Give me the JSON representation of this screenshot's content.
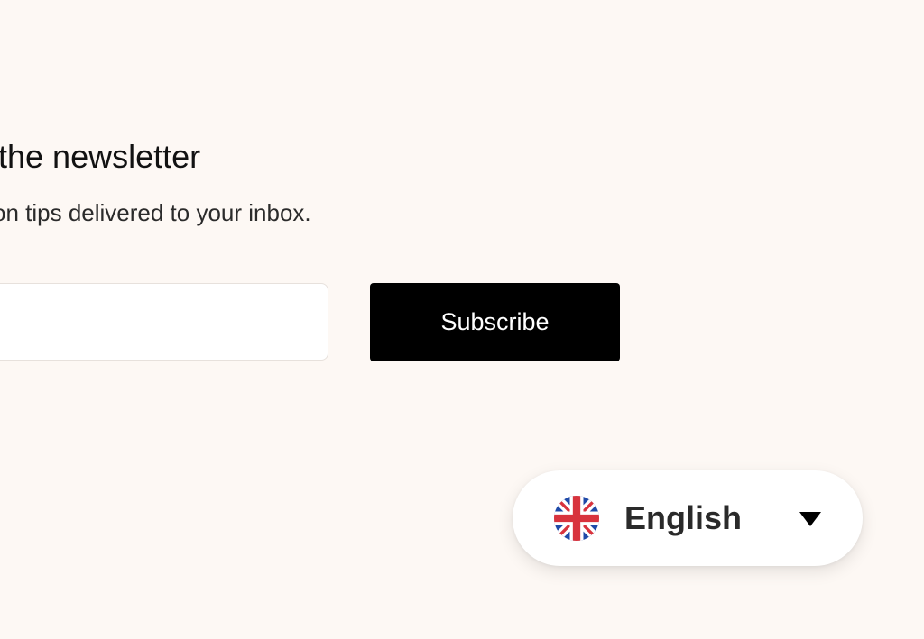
{
  "newsletter": {
    "title": "the newsletter",
    "subtitle": "on tips delivered to your inbox.",
    "email_value": "",
    "subscribe_label": "Subscribe"
  },
  "language_switcher": {
    "flag_icon": "uk-flag-icon",
    "label": "English",
    "caret_icon": "caret-down-icon"
  },
  "colors": {
    "background": "#fdf8f4",
    "button_background": "#000000",
    "button_text": "#ffffff"
  }
}
